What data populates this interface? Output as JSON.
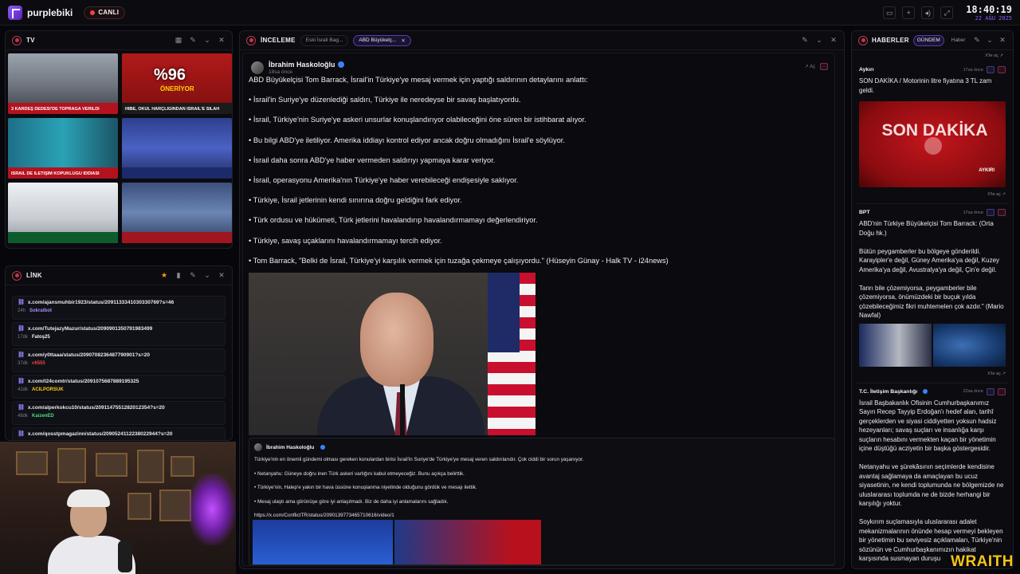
{
  "app": {
    "name": "purplebiki",
    "live_label": "CANLI",
    "clock_time": "18:40:19",
    "clock_date": "22 AĞU 2025"
  },
  "colors": {
    "accent": "#8b5cf6",
    "live": "#ef4444",
    "breaking": "#b3121f",
    "verified": "#3b82f6"
  },
  "tv": {
    "title": "TV",
    "thumbnails": [
      {
        "caption": "3 KARDEŞ DEDESİ'DE TOPRAĞA VERİLDİ",
        "overlay": ""
      },
      {
        "caption": "HİBE, OKUL HARÇLIĞINDAN İSRAİL'E SİLAH",
        "overlay": "%96",
        "overlay_sub": "ÖNERİYOR"
      },
      {
        "caption": "İSRAİL DE İLETİŞİM KOPUKLUĞU İDDİASI",
        "overlay": ""
      },
      {
        "caption": "",
        "overlay": ""
      },
      {
        "caption": "",
        "overlay": ""
      },
      {
        "caption": "",
        "overlay": ""
      }
    ]
  },
  "link": {
    "title": "LİNK",
    "items": [
      {
        "url": "x.com/ajansmuhbir1923/status/2091133341030330769?s=46",
        "age": "24h",
        "user": "Sokratbot",
        "user_color": "#a78bfa"
      },
      {
        "url": "x.com/TutejazyMazur/status/2090901350791983499",
        "age": "17dk",
        "user": "Fatoş25",
        "user_color": "#f4f4f6"
      },
      {
        "url": "x.com/y0ttaaa/status/2090708236487790901?s=20",
        "age": "37dk",
        "user": "c6555",
        "user_color": "#ef4444"
      },
      {
        "url": "x.com/t24comtr/status/2091075687889195325",
        "age": "42dk",
        "user": "ACILPORSUK",
        "user_color": "#facc15"
      },
      {
        "url": "x.com/alperkokcu10/status/2091147551282012354?s=20",
        "age": "48dk",
        "user": "KaizenED",
        "user_color": "#4ade80"
      },
      {
        "url": "x.com/qosstpmagazinn/status/2090524112238022944?s=20",
        "age": "",
        "user": "",
        "user_color": "#f4f4f6"
      }
    ]
  },
  "inceleme": {
    "title": "İNCELEME",
    "tabs": [
      {
        "label": "Eski İsrail Bag..."
      },
      {
        "label": "ABD Büyükelç..."
      }
    ],
    "post": {
      "author": "İbrahim Haskoloğlu",
      "time": "18sa önce",
      "open_label": "Aç",
      "lines": [
        "ABD Büyükelçisi Tom Barrack, İsrail'in Türkiye'ye mesaj vermek için yaptığı saldırının detaylarını anlattı:",
        "• İsrail'in Suriye'ye düzenlediği saldırı, Türkiye ile neredeyse bir savaş başlatıyordu.",
        "• İsrail, Türkiye'nin Suriye'ye askeri unsurlar konuşlandırıyor olabileceğini öne süren bir istihbarat alıyor.",
        "• Bu bilgi ABD'ye iletiliyor. Amerika iddiayı kontrol ediyor ancak doğru olmadığını İsrail'e söylüyor.",
        "• İsrail daha sonra ABD'ye haber vermeden saldırıyı yapmaya karar veriyor.",
        "• İsrail, operasyonu Amerika'nın Türkiye'ye haber verebileceği endişesiyle saklıyor.",
        "• Türkiye, İsrail jetlerinin kendi sınırına doğru geldiğini fark ediyor.",
        "• Türk ordusu ve hükümeti, Türk jetlerini havalandırıp havalandırmamayı değerlendiriyor.",
        "• Türkiye, savaş uçaklarını havalandırmamayı tercih ediyor.",
        "• Tom Barrack, \"Belki de İsrail, Türkiye'yi karşılık vermek için tuzağa çekmeye çalışıyordu.\" (Hüseyin Günay - Halk TV - i24news)"
      ]
    },
    "quoted": {
      "author": "İbrahim Haskoloğlu",
      "lines": [
        "Türkiye'nin en önemli gündemi olması gereken konulardan birisi İsrail'in Suriye'de Türkiye'ye mesaj veren saldırılarıdır. Çok ciddi bir sorun yaşanıyor.",
        "• Netanyahu: Güneye doğru inen Türk askeri varlığını kabul etmeyeceğiz. Bunu açıkça belirttik.",
        "• Türkiye'nin, Halep'e yakın bir hava üssüne konuşlanma niyetinde olduğunu gördük ve mesajı ilettik.",
        "• Mesaj ulaştı ama görünüşe göre iyi anlaşılmadı. Biz de daha iyi anlamalarını sağladık.",
        "https://x.com/ConflictTR/status/2090139773465710616/video/1"
      ]
    }
  },
  "haberler": {
    "title": "HABERLER",
    "tabs": [
      {
        "label": "GÜNDEM"
      },
      {
        "label": "Haber"
      }
    ],
    "open_label": "X'te aç",
    "items": [
      {
        "source": "Aykırı",
        "time": "17sa önce",
        "text": "SON DAKİKA / Motorinin litre fiyatına 3 TL zam geldi.",
        "image_text": "SON DAKİKA",
        "image_sub": "AYKIRI"
      },
      {
        "source": "BPT",
        "time": "17sa önce",
        "text": "ABD'nin Türkiye Büyükelçisi Tom Barrack: (Orta Doğu hk.)\n\nBütün peygamberler bu bölgeye gönderildi. Karayipler'e değil, Güney Amerika'ya değil, Kuzey Amerika'ya değil, Avustralya'ya değil, Çin'e değil.\n\nTanrı bile çözemiyorsa, peygamberler bile çözemiyorsa, önümüzdeki bir buçuk yılda çözebileceğimiz fikri muhtemelen çok azdır.\" (Mario Nawfal)"
      },
      {
        "source": "T.C. İletişim Başkanlığı",
        "time": "22sa önce",
        "text": "İsrail Başbakanlık Ofisinin Cumhurbaşkanımız Sayın Recep Tayyip Erdoğan'ı hedef alan, tarihî gerçeklerden ve siyasi ciddiyetten yoksun hadsiz hezeyanları; savaş suçları ve insanlığa karşı suçların hesabını vermekten kaçan bir yönetimin içine düştüğü acziyetin bir başka göstergesidir.\n\nNetanyahu ve şürekâsının seçimlerde kendisine avantaj sağlamaya da amaçlayan bu ucuz siyasetinin, ne kendi toplumunda ne bölgemizde ne uluslararası toplumda ne de bizde herhangi bir karşılığı yoktur.\n\nSoykırım suçlamasıyla uluslararası adalet mekanizmalarının önünde hesap vermeyi bekleyen bir yönetimin bu seviyesiz açıklamaları, Türkiye'nin sözünün ve Cumhurbaşkanımızın hakikat karşısında susmayan duruşu"
      }
    ]
  },
  "watermark": "WRAITH"
}
